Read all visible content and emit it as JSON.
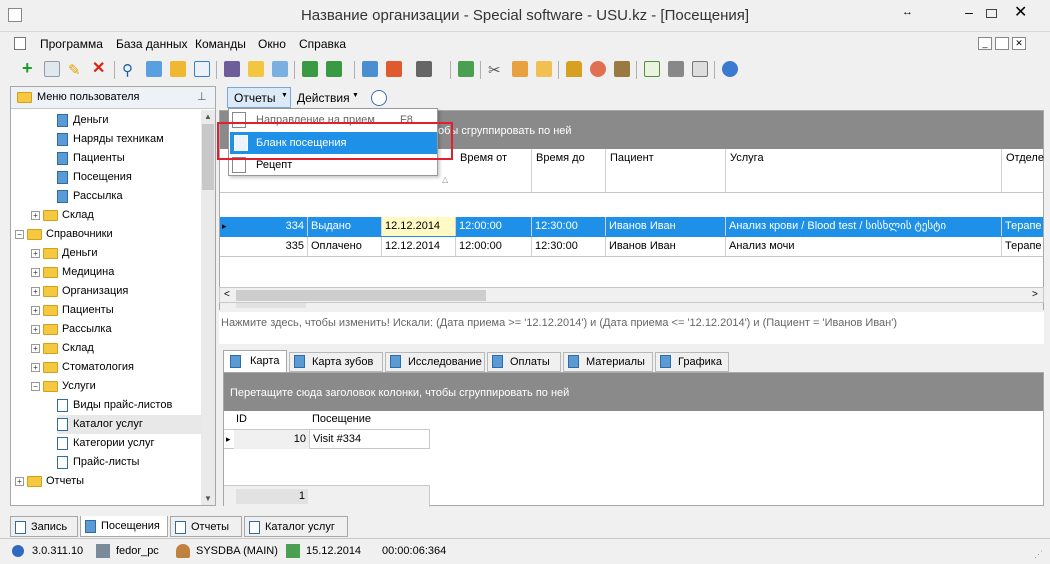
{
  "window": {
    "title": "Название организации - Special software - USU.kz - [Посещения]"
  },
  "menubar": [
    "Программа",
    "База данных",
    "Команды",
    "Окно",
    "Справка"
  ],
  "left_panel": {
    "header": "Меню пользователя",
    "items": [
      {
        "label": "Деньги",
        "level": 3,
        "type": "doc"
      },
      {
        "label": "Наряды техникам",
        "level": 3,
        "type": "doc"
      },
      {
        "label": "Пациенты",
        "level": 3,
        "type": "doc"
      },
      {
        "label": "Посещения",
        "level": 3,
        "type": "doc"
      },
      {
        "label": "Рассылка",
        "level": 3,
        "type": "doc"
      },
      {
        "label": "Склад",
        "level": 2,
        "type": "folder"
      },
      {
        "label": "Справочники",
        "level": 1,
        "type": "folder-open"
      },
      {
        "label": "Деньги",
        "level": 2,
        "type": "folder"
      },
      {
        "label": "Медицина",
        "level": 2,
        "type": "folder"
      },
      {
        "label": "Организация",
        "level": 2,
        "type": "folder"
      },
      {
        "label": "Пациенты",
        "level": 2,
        "type": "folder"
      },
      {
        "label": "Рассылка",
        "level": 2,
        "type": "folder"
      },
      {
        "label": "Склад",
        "level": 2,
        "type": "folder"
      },
      {
        "label": "Стоматология",
        "level": 2,
        "type": "folder"
      },
      {
        "label": "Услуги",
        "level": 2,
        "type": "folder-open"
      },
      {
        "label": "Виды прайс-листов",
        "level": 3,
        "type": "list"
      },
      {
        "label": "Каталог услуг",
        "level": 3,
        "type": "list"
      },
      {
        "label": "Категории услуг",
        "level": 3,
        "type": "list"
      },
      {
        "label": "Прайс-листы",
        "level": 3,
        "type": "list"
      },
      {
        "label": "Отчеты",
        "level": 1,
        "type": "folder"
      }
    ]
  },
  "main_toolbar": {
    "reports": "Отчеты",
    "actions": "Действия"
  },
  "dropdown": {
    "items": [
      "Направление на прием",
      "Бланк посещения",
      "Рецепт"
    ],
    "shortcut": "F8"
  },
  "grid": {
    "group_hint": "обы сгруппировать по ней",
    "columns": [
      "Время от",
      "Время до",
      "Пациент",
      "Услуга",
      "Отделе"
    ],
    "rows": [
      {
        "id": "334",
        "status": "Выдано",
        "date": "12.12.2014",
        "from": "12:00:00",
        "to": "12:30:00",
        "patient": "Иванов Иван",
        "service": "Анализ крови / Blood test / სისხლის ტესტი",
        "dept": "Терапе"
      },
      {
        "id": "335",
        "status": "Оплачено",
        "date": "12.12.2014",
        "from": "12:00:00",
        "to": "12:30:00",
        "patient": "Иванов Иван",
        "service": "Анализ мочи",
        "dept": "Терапе"
      }
    ],
    "count": "2"
  },
  "filter_text": "Нажмите здесь, чтобы изменить! Искали: (Дата приема  >= '12.12.2014') и (Дата приема  <= '12.12.2014') и (Пациент = 'Иванов Иван')",
  "detail_tabs": [
    "Карта",
    "Карта зубов",
    "Исследование",
    "Оплаты",
    "Материалы",
    "Графика"
  ],
  "detail": {
    "group_hint": "Перетащите сюда заголовок колонки, чтобы сгруппировать по ней",
    "columns": [
      "ID",
      "Посещение"
    ],
    "rows": [
      {
        "id": "10",
        "visit": "Visit #334"
      }
    ],
    "count": "1"
  },
  "bottom_tabs": [
    "Запись",
    "Посещения",
    "Отчеты",
    "Каталог услуг"
  ],
  "status": {
    "version": "3.0.311.10",
    "pc": "fedor_pc",
    "user": "SYSDBA (MAIN)",
    "date": "15.12.2014",
    "timer": "00:00:06:364"
  }
}
